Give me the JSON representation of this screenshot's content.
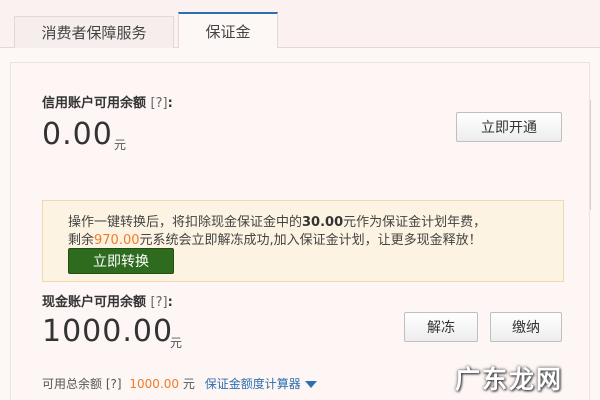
{
  "tabs": [
    {
      "label": "消费者保障服务"
    },
    {
      "label": "保证金"
    }
  ],
  "credit": {
    "label": "信用账户可用余额",
    "help": "[?]",
    "colon": ":",
    "amount": "0.00",
    "unit": "元",
    "open_button": "立即开通"
  },
  "notice": {
    "line1_prefix": "操作一键转换后，将扣除现金保证金中的",
    "line1_amount": "30.00",
    "line1_suffix": "元作为保证金计划年费，",
    "line2_prefix": "剩余",
    "line2_amount": "970.00",
    "line2_suffix": "元系统会立即解冻成功,加入保证金计划，让更多现金释放！",
    "convert_button": "立即转换"
  },
  "cash": {
    "label": "现金账户可用余额",
    "help": "[?]",
    "colon": ":",
    "amount": "1000.00",
    "unit": "元",
    "unfreeze_button": "解冻",
    "pay_button": "缴纳"
  },
  "footer": {
    "label": "可用总余额",
    "help": "[?]",
    "amount": "1000.00",
    "unit": "元",
    "calculator_link": "保证金额度计算器"
  },
  "watermark": "广东龙网",
  "colors": {
    "accent_blue": "#2d6fb0",
    "highlight_orange": "#f07c2a",
    "convert_green": "#2e6b1e",
    "notice_bg": "#fcf3e2"
  }
}
